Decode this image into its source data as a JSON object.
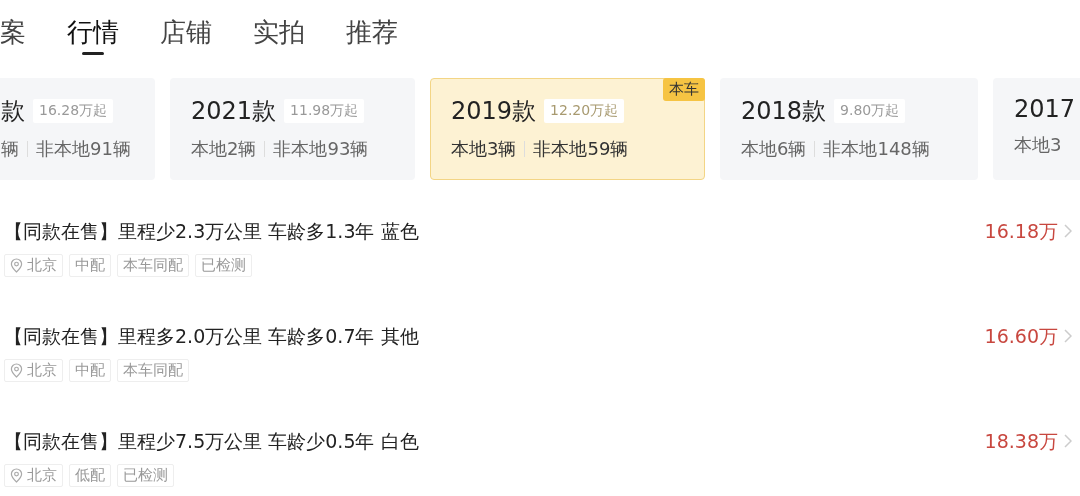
{
  "tabs": [
    {
      "label": "案",
      "selected": false
    },
    {
      "label": "行情",
      "selected": true
    },
    {
      "label": "店铺",
      "selected": false
    },
    {
      "label": "实拍",
      "selected": false
    },
    {
      "label": "推荐",
      "selected": false
    }
  ],
  "year_cards": [
    {
      "year": "款",
      "price": "16.28万起",
      "local": "辆",
      "nonlocal": "非本地91辆",
      "selected": false
    },
    {
      "year": "2021款",
      "price": "11.98万起",
      "local": "本地2辆",
      "nonlocal": "非本地93辆",
      "selected": false
    },
    {
      "year": "2019款",
      "price": "12.20万起",
      "local": "本地3辆",
      "nonlocal": "非本地59辆",
      "selected": true,
      "badge": "本车"
    },
    {
      "year": "2018款",
      "price": "9.80万起",
      "local": "本地6辆",
      "nonlocal": "非本地148辆",
      "selected": false
    },
    {
      "year": "2017",
      "local": "本地3",
      "selected": false
    }
  ],
  "listings": [
    {
      "title": "【同款在售】里程少2.3万公里 车龄多1.3年 蓝色",
      "price": "16.18万",
      "tags": [
        {
          "text": "北京",
          "kind": "location"
        },
        {
          "text": "中配",
          "kind": "plain"
        },
        {
          "text": "本车同配",
          "kind": "plain"
        },
        {
          "text": "已检测",
          "kind": "plain"
        }
      ]
    },
    {
      "title": "【同款在售】里程多2.0万公里 车龄多0.7年 其他",
      "price": "16.60万",
      "tags": [
        {
          "text": "北京",
          "kind": "location"
        },
        {
          "text": "中配",
          "kind": "plain"
        },
        {
          "text": "本车同配",
          "kind": "plain"
        }
      ]
    },
    {
      "title": "【同款在售】里程少7.5万公里 车龄少0.5年 白色",
      "price": "18.38万",
      "tags": [
        {
          "text": "北京",
          "kind": "location"
        },
        {
          "text": "低配",
          "kind": "plain"
        },
        {
          "text": "已检测",
          "kind": "plain"
        }
      ]
    }
  ]
}
